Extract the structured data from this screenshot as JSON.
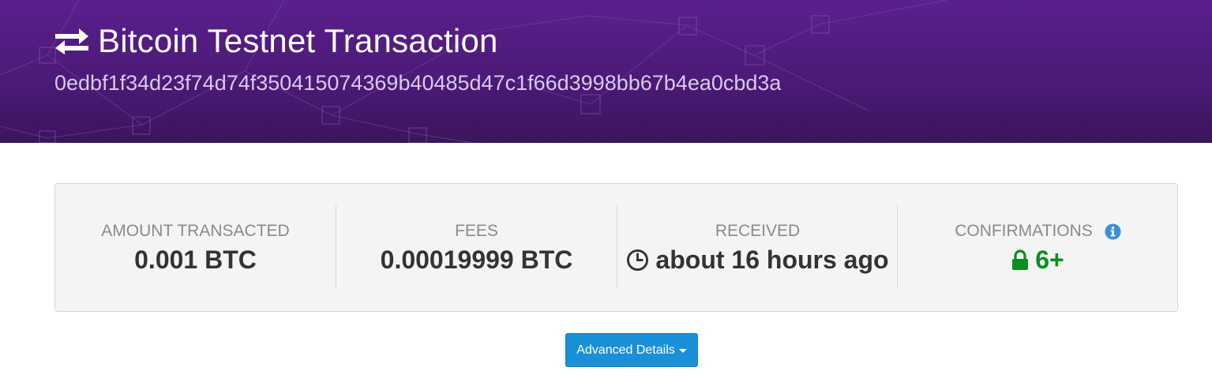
{
  "header": {
    "title": "Bitcoin Testnet Transaction",
    "txid": "0edbf1f34d23f74d74f350415074369b40485d47c1f66d3998bb67b4ea0cbd3a",
    "icon": "exchange-arrows-icon"
  },
  "stats": {
    "amount": {
      "label": "AMOUNT TRANSACTED",
      "value": "0.001 BTC"
    },
    "fees": {
      "label": "FEES",
      "value": "0.00019999 BTC"
    },
    "received": {
      "label": "RECEIVED",
      "value": "about 16 hours ago",
      "icon": "clock-icon"
    },
    "confirmations": {
      "label": "CONFIRMATIONS",
      "value": "6+",
      "icon": "lock-icon",
      "info_icon": "info-icon"
    }
  },
  "actions": {
    "advanced_label": "Advanced Details"
  },
  "colors": {
    "header_purple": "#4c1a78",
    "confirm_green": "#0a8f1e",
    "button_blue": "#1a90d8",
    "info_blue": "#3d8fd6"
  }
}
